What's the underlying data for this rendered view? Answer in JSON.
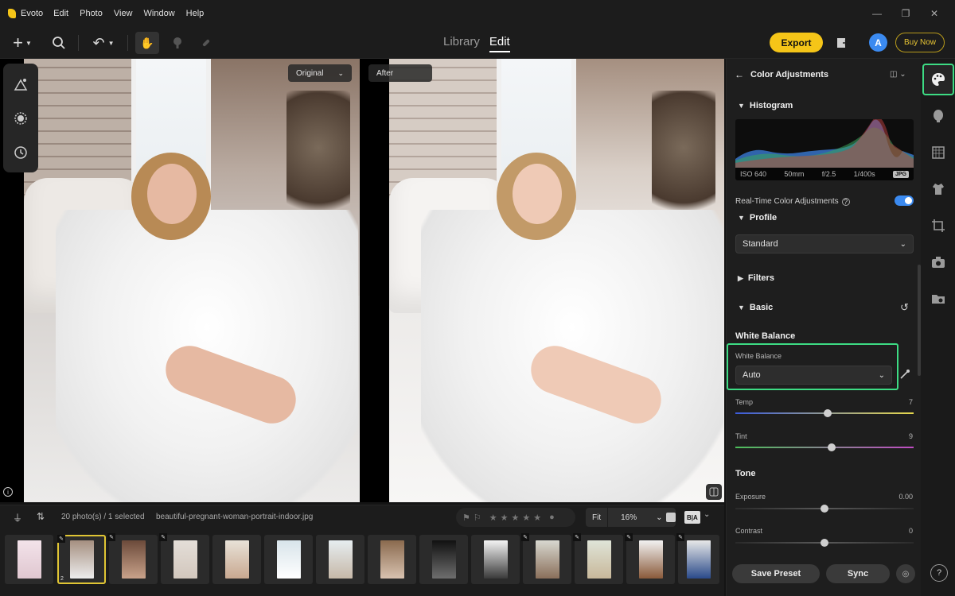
{
  "app": {
    "name": "Evoto",
    "menu": [
      "Edit",
      "Photo",
      "View",
      "Window",
      "Help"
    ]
  },
  "window_controls": {
    "minimize": "—",
    "restore": "❐",
    "close": "✕"
  },
  "toolbar": {
    "add": "+",
    "search": "🔍",
    "undo": "↶",
    "hand": "✋",
    "modes": {
      "library": "Library",
      "edit": "Edit"
    },
    "export_label": "Export",
    "avatar_initial": "A",
    "buy_label": "Buy Now"
  },
  "view_tags": {
    "original": "Original",
    "after": "After"
  },
  "panel": {
    "title": "Color Adjustments",
    "histogram": {
      "title": "Histogram",
      "iso": "ISO 640",
      "focal": "50mm",
      "aperture": "f/2.5",
      "shutter": "1/400s",
      "format": "JPG"
    },
    "realtime_label": "Real-Time Color Adjustments",
    "realtime_on": true,
    "profile": {
      "title": "Profile",
      "value": "Standard"
    },
    "filters_title": "Filters",
    "basic_title": "Basic",
    "white_balance": {
      "heading": "White Balance",
      "label": "White Balance",
      "value": "Auto"
    },
    "temp": {
      "label": "Temp",
      "value": "7",
      "level": 0.52
    },
    "tint": {
      "label": "Tint",
      "value": "9",
      "level": 0.54
    },
    "tone_title": "Tone",
    "exposure": {
      "label": "Exposure",
      "value": "0.00",
      "level": 0.5
    },
    "contrast": {
      "label": "Contrast",
      "value": "0",
      "level": 0.5
    },
    "save_preset": "Save Preset",
    "sync": "Sync"
  },
  "bottom": {
    "count_label": "20 photo(s) / 1 selected",
    "filename": "beautiful-pregnant-woman-portrait-indoor.jpg",
    "fit_label": "Fit",
    "zoom": "16%",
    "ba_label": "B|A"
  },
  "thumb_selected_index": "2",
  "colors": {
    "accent_green": "#3ddc84",
    "export_yellow": "#f5c518",
    "toggle_blue": "#3b8af0"
  }
}
